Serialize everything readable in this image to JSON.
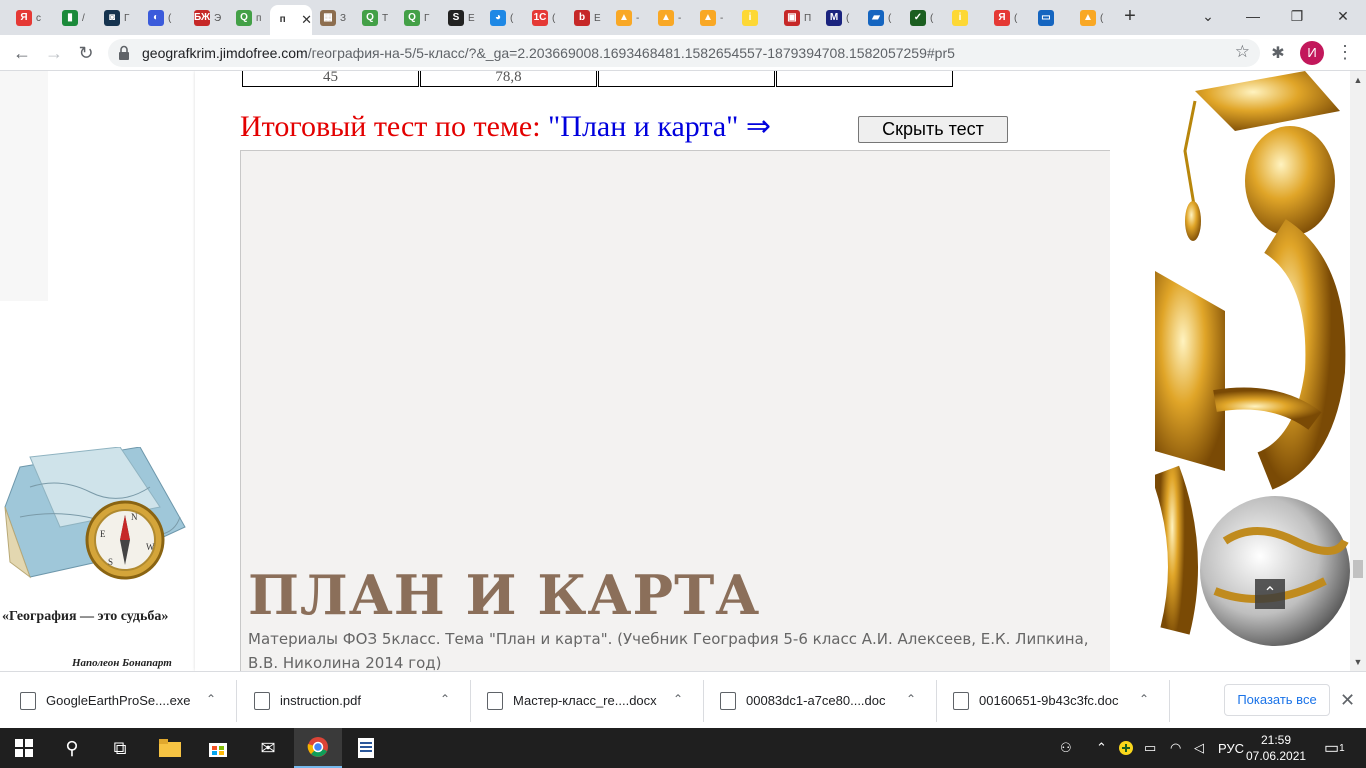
{
  "browser": {
    "tabs": [
      {
        "icon": "yandex-icon",
        "color": "#e53935",
        "glyph": "Я",
        "title": "с"
      },
      {
        "icon": "doc-icon",
        "color": "#1b8a3a",
        "glyph": "▮",
        "title": "/"
      },
      {
        "icon": "qr-icon",
        "color": "#15334f",
        "glyph": "◙",
        "title": "Г"
      },
      {
        "icon": "globe-icon",
        "color": "#3b5bdb",
        "glyph": "◐",
        "title": "("
      },
      {
        "icon": "book-icon",
        "color": "#c62828",
        "glyph": "БЖ",
        "title": "Э"
      },
      {
        "icon": "q-icon",
        "color": "#43a047",
        "glyph": "Q",
        "title": "п"
      },
      {
        "icon": "page-icon",
        "color": "#ffffff",
        "glyph": "п",
        "title": ""
      },
      {
        "icon": "map-icon",
        "color": "#8d6e4f",
        "glyph": "▦",
        "title": "З"
      },
      {
        "icon": "q-icon",
        "color": "#43a047",
        "glyph": "Q",
        "title": "Т"
      },
      {
        "icon": "q-icon",
        "color": "#43a047",
        "glyph": "Q",
        "title": "Г"
      },
      {
        "icon": "s-icon",
        "color": "#222222",
        "glyph": "S",
        "title": "Е"
      },
      {
        "icon": "edge-icon",
        "color": "#1e88e5",
        "glyph": "◕",
        "title": "("
      },
      {
        "icon": "1c-icon",
        "color": "#e53935",
        "glyph": "1С",
        "title": "("
      },
      {
        "icon": "b-icon",
        "color": "#c62828",
        "glyph": "b",
        "title": "Е"
      },
      {
        "icon": "hat-icon",
        "color": "#f9a825",
        "glyph": "▲",
        "title": "-"
      },
      {
        "icon": "hat-icon",
        "color": "#f9a825",
        "glyph": "▲",
        "title": "-"
      },
      {
        "icon": "hat-icon",
        "color": "#f9a825",
        "glyph": "▲",
        "title": "-"
      },
      {
        "icon": "info-icon",
        "color": "#fdd835",
        "glyph": "i",
        "title": ""
      },
      {
        "icon": "slides-icon",
        "color": "#c62828",
        "glyph": "▣",
        "title": "П"
      },
      {
        "icon": "m-icon",
        "color": "#1a237e",
        "glyph": "M",
        "title": "("
      },
      {
        "icon": "book-icon",
        "color": "#1565c0",
        "glyph": "▰",
        "title": "("
      },
      {
        "icon": "check-icon",
        "color": "#1b5e20",
        "glyph": "✓",
        "title": "("
      },
      {
        "icon": "info-icon",
        "color": "#fdd835",
        "glyph": "i",
        "title": ""
      },
      {
        "icon": "yandex-icon",
        "color": "#e53935",
        "glyph": "Я",
        "title": "("
      },
      {
        "icon": "monitor-icon",
        "color": "#1565c0",
        "glyph": "▭",
        "title": ""
      },
      {
        "icon": "image-icon",
        "color": "#f9a825",
        "glyph": "▲",
        "title": "("
      }
    ],
    "active_tab_glyph": "п",
    "url_host": "geografkrim.jimdofree.com",
    "url_path": "/география-на-5/5-класс/?&_ga=2.203669008.1693468481.1582654557-1879394708.1582057259#pr5",
    "avatar_letter": "И"
  },
  "page": {
    "table_row": [
      "45",
      "78,8",
      "",
      ""
    ],
    "heading_prefix": "Итоговый тест по теме: ",
    "heading_topic": "\"План и карта\"",
    "heading_arrow": " ⇒",
    "hide_button": "Скрыть тест",
    "embed_title": "ПЛАН И КАРТА",
    "embed_description": "Материалы ФОЗ 5класс. Тема \"План и карта\". (Учебник География 5-6 класс А.И. Алексеев, Е.К. Липкина, В.В. Николина 2014 год)",
    "quote": "«География — это судьба»",
    "quote_author": "Наполеон Бонапарт"
  },
  "downloads": {
    "items": [
      {
        "name": "GoogleEarthProSe....exe",
        "icon": "exe-icon"
      },
      {
        "name": "instruction.pdf",
        "icon": "pdf-icon"
      },
      {
        "name": "Мастер-класс_re....docx",
        "icon": "doc-icon"
      },
      {
        "name": "00083dc1-a7ce80....doc",
        "icon": "doc-icon"
      },
      {
        "name": "00160651-9b43c3fc.doc",
        "icon": "doc-icon"
      }
    ],
    "show_all": "Показать все"
  },
  "taskbar": {
    "language": "РУС",
    "time": "21:59",
    "date": "07.06.2021",
    "notifications": "1"
  }
}
